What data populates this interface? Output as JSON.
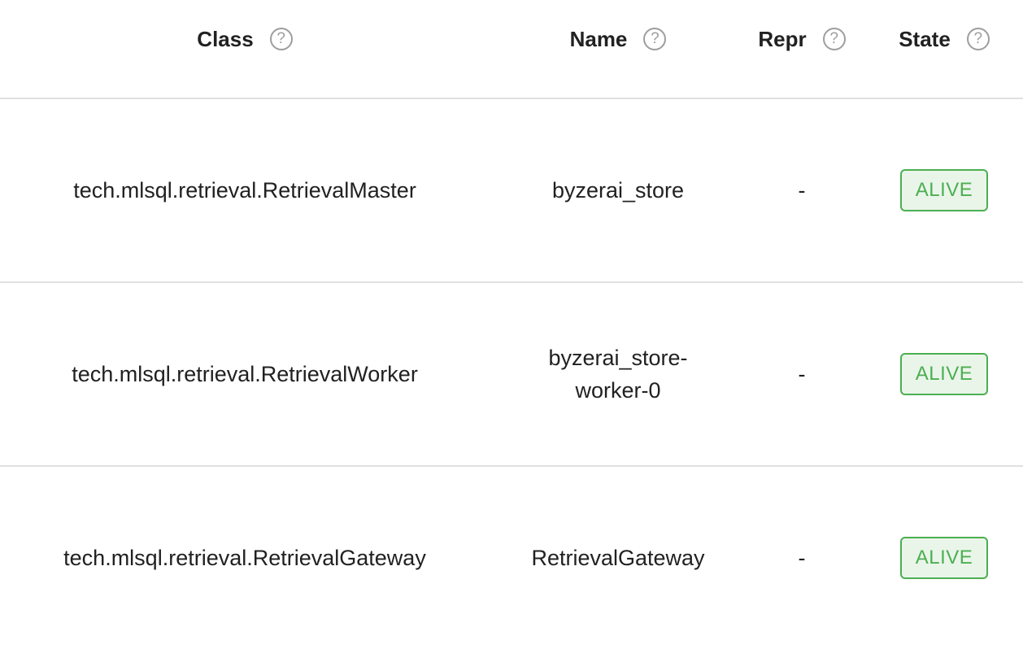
{
  "header": {
    "columns": [
      {
        "label": "Class",
        "help": "?"
      },
      {
        "label": "Name",
        "help": "?"
      },
      {
        "label": "Repr",
        "help": "?"
      },
      {
        "label": "State",
        "help": "?"
      }
    ]
  },
  "rows": [
    {
      "class": "tech.mlsql.retrieval.RetrievalMaster",
      "name": "byzerai_store",
      "repr": "-",
      "state": "ALIVE"
    },
    {
      "class": "tech.mlsql.retrieval.RetrievalWorker",
      "name": "byzerai_store-worker-0",
      "repr": "-",
      "state": "ALIVE"
    },
    {
      "class": "tech.mlsql.retrieval.RetrievalGateway",
      "name": "RetrievalGateway",
      "repr": "-",
      "state": "ALIVE"
    }
  ],
  "colors": {
    "alive_text": "#4caf50",
    "alive_bg": "#eaf5ea",
    "divider": "#e0e0e0",
    "help_icon": "#9e9e9e"
  },
  "icons": {
    "help": "help-circle-icon"
  }
}
